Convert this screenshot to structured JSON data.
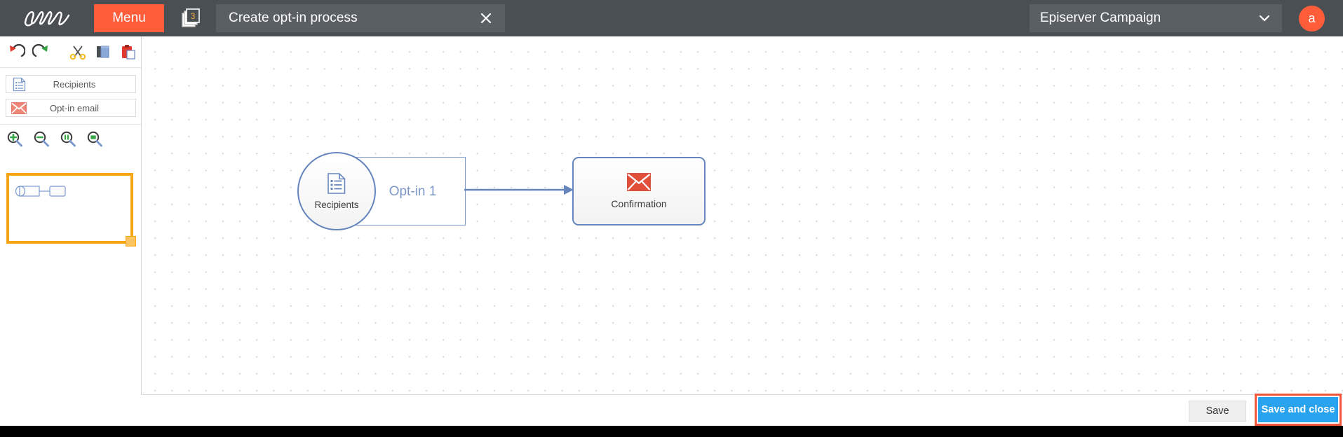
{
  "topbar": {
    "logo_icon": "episerver-logo-icon",
    "menu_label": "Menu",
    "doc_stack_icon": "document-stack-icon",
    "doc_stack_count": "3",
    "tab_title": "Create opt-in process",
    "tab_close_icon": "close-icon",
    "account_name": "Episerver Campaign",
    "account_caret_icon": "chevron-down-icon",
    "avatar_initial": "a",
    "colors": {
      "bar_bg": "#4a4f54",
      "tab_bg": "#5a5f64",
      "accent_orange": "#ff5c39"
    }
  },
  "sidebar": {
    "edit_tools": [
      {
        "name": "undo-icon",
        "title": "Undo"
      },
      {
        "name": "redo-icon",
        "title": "Redo"
      },
      {
        "name": "cut-icon",
        "title": "Cut"
      },
      {
        "name": "copy-icon",
        "title": "Copy"
      },
      {
        "name": "paste-icon",
        "title": "Paste"
      }
    ],
    "palette": [
      {
        "label": "Recipients",
        "icon": "recipients-list-icon"
      },
      {
        "label": "Opt-in email",
        "icon": "envelope-icon"
      }
    ],
    "zoom_tools": [
      {
        "name": "zoom-in-icon",
        "title": "Zoom in"
      },
      {
        "name": "zoom-out-icon",
        "title": "Zoom out"
      },
      {
        "name": "zoom-fit-width-icon",
        "title": "Fit width"
      },
      {
        "name": "zoom-fit-page-icon",
        "title": "Fit page"
      }
    ],
    "minimap": {
      "name": "minimap-overview",
      "handle_icon": "resize-handle-icon"
    }
  },
  "canvas": {
    "nodes": [
      {
        "id": "optin-container",
        "label": "Opt-in 1",
        "type": "container"
      },
      {
        "id": "recipients",
        "label": "Recipients",
        "icon": "recipients-list-icon",
        "type": "start-circle"
      },
      {
        "id": "confirmation",
        "label": "Confirmation",
        "icon": "envelope-icon",
        "type": "email-box"
      }
    ],
    "connectors": [
      {
        "from": "optin-container",
        "to": "confirmation",
        "arrow": "arrow-right-icon"
      }
    ],
    "colors": {
      "node_border": "#6685bd",
      "container_border": "#7c96c7",
      "label_text": "#7c96c7",
      "grid_dot": "#d6d6d6"
    }
  },
  "footer": {
    "save_label": "Save",
    "save_close_label": "Save and close",
    "highlight_color": "#f4553d",
    "primary_color": "#2aa3ef"
  }
}
